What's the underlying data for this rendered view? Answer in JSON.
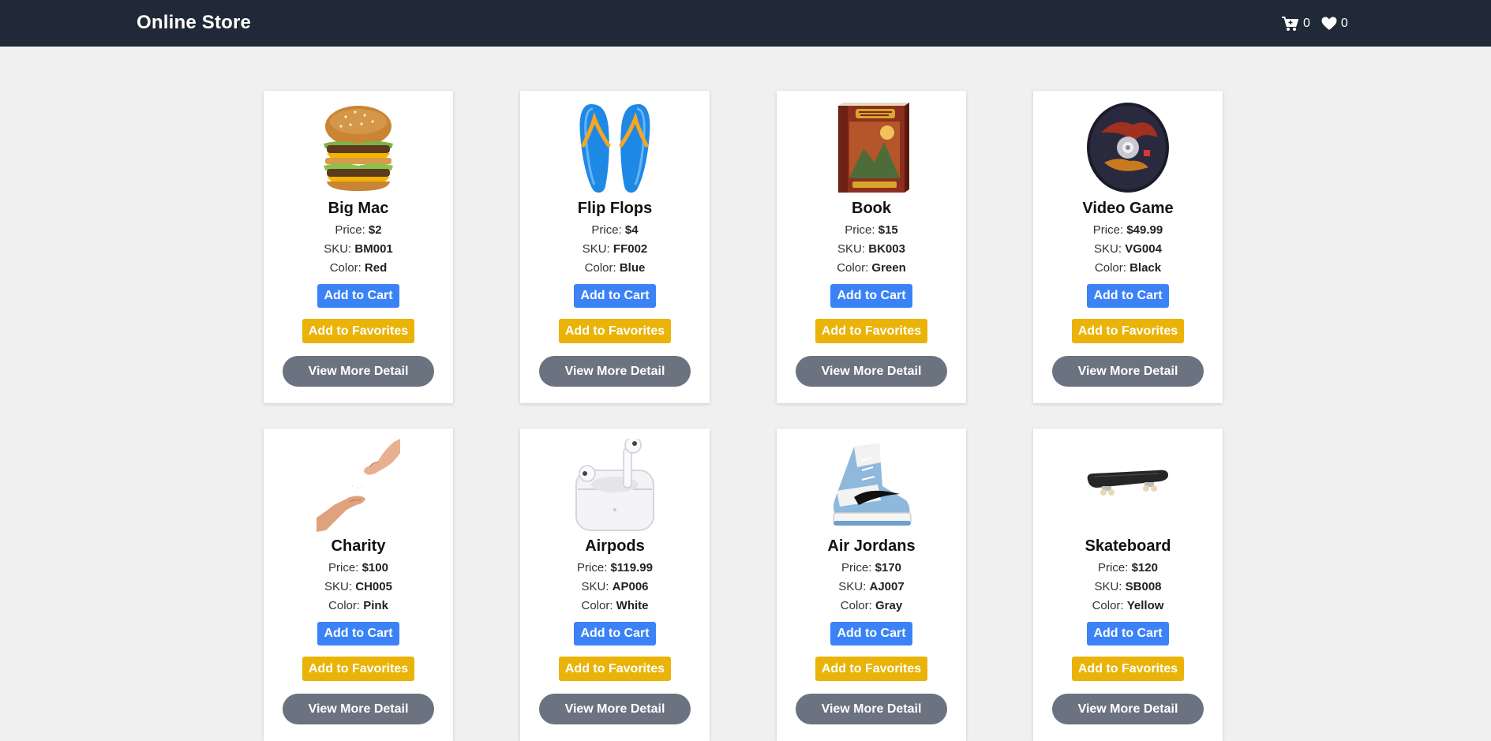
{
  "header": {
    "brand": "Online Store",
    "cart_icon": "cart-icon",
    "cart_count": "0",
    "favorites_icon": "heart-icon",
    "favorites_count": "0"
  },
  "colors": {
    "navbar": "#1f2937",
    "cart_button": "#3b82f6",
    "favorites_button": "#eab308",
    "detail_button": "#6b7280"
  },
  "labels": {
    "price": "Price:",
    "sku": "SKU:",
    "color": "Color:",
    "add_to_cart": "Add to Cart",
    "add_to_favorites": "Add to Favorites",
    "view_more_detail": "View More Detail"
  },
  "products": [
    {
      "name": "Big Mac",
      "image": "burger-image",
      "price": "$2",
      "sku": "BM001",
      "color": "Red"
    },
    {
      "name": "Flip Flops",
      "image": "flip-flops-image",
      "price": "$4",
      "sku": "FF002",
      "color": "Blue"
    },
    {
      "name": "Book",
      "image": "book-image",
      "price": "$15",
      "sku": "BK003",
      "color": "Green"
    },
    {
      "name": "Video Game",
      "image": "game-disc-image",
      "price": "$49.99",
      "sku": "VG004",
      "color": "Black"
    },
    {
      "name": "Charity",
      "image": "giving-hands-image",
      "price": "$100",
      "sku": "CH005",
      "color": "Pink"
    },
    {
      "name": "Airpods",
      "image": "airpods-image",
      "price": "$119.99",
      "sku": "AP006",
      "color": "White"
    },
    {
      "name": "Air Jordans",
      "image": "sneaker-image",
      "price": "$170",
      "sku": "AJ007",
      "color": "Gray"
    },
    {
      "name": "Skateboard",
      "image": "skateboard-image",
      "price": "$120",
      "sku": "SB008",
      "color": "Yellow"
    }
  ]
}
